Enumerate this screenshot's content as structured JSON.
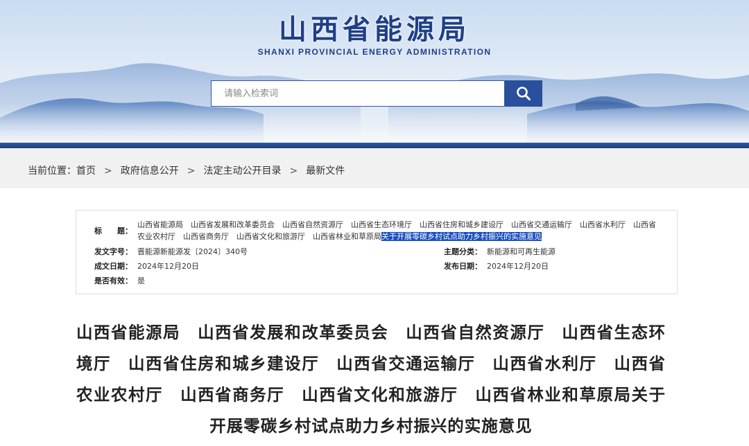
{
  "header": {
    "logo_cn": "山西省能源局",
    "logo_en": "SHANXI PROVINCIAL ENERGY ADMINISTRATION",
    "search_placeholder": "请输入检索词",
    "search_icon": "search-icon",
    "colors": {
      "brand": "#1f3f86",
      "search_button": "#2a4f9c"
    }
  },
  "breadcrumb": {
    "prefix": "当前位置：",
    "items": [
      "首页",
      "政府信息公开",
      "法定主动公开目录",
      "最新文件"
    ],
    "separator": ">"
  },
  "info": {
    "title_label": "标　　题：",
    "title_plain": "山西省能源局　山西省发展和改革委员会　山西省自然资源厅　山西省生态环境厅　山西省住房和城乡建设厅　山西省交通运输厅　山西省水利厅　山西省农业农村厅　山西省商务厅　山西省文化和旅游厅　山西省林业和草原局",
    "title_highlight": "关于开展零碳乡村试点助力乡村振兴的实施意见",
    "doc_no_label": "发文字号：",
    "doc_no": "晋能源新能源发〔2024〕340号",
    "category_label": "主题分类：",
    "category": "新能源和可再生能源",
    "created_label": "成文日期：",
    "created": "2024年12月20日",
    "published_label": "发布日期：",
    "published": "2024年12月20日",
    "valid_label": "是否有效：",
    "valid": "是",
    "highlight_color": "#1c4fc0"
  },
  "document": {
    "title": "山西省能源局　山西省发展和改革委员会　山西省自然资源厅　山西省生态环境厅　山西省住房和城乡建设厅　山西省交通运输厅　山西省水利厅　山西省农业农村厅　山西省商务厅　山西省文化和旅游厅　山西省林业和草原局关于开展零碳乡村试点助力乡村振兴的实施意见"
  }
}
